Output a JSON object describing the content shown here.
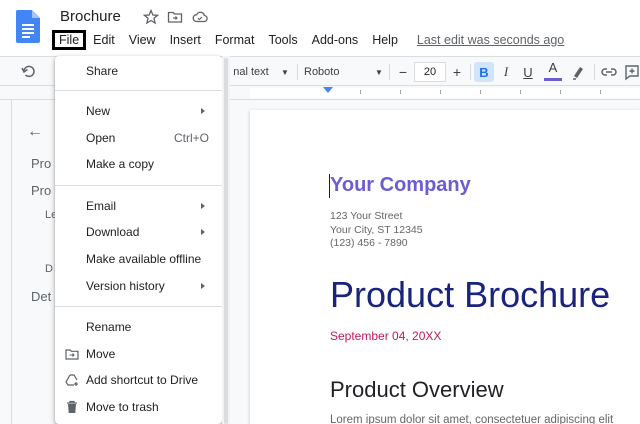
{
  "app": {
    "doc_title": "Brochure",
    "last_edit": "Last edit was seconds ago"
  },
  "menubar": [
    {
      "label": "File",
      "active": true
    },
    {
      "label": "Edit"
    },
    {
      "label": "View"
    },
    {
      "label": "Insert"
    },
    {
      "label": "Format"
    },
    {
      "label": "Tools"
    },
    {
      "label": "Add-ons"
    },
    {
      "label": "Help"
    }
  ],
  "toolbar": {
    "style_label": "nal text",
    "font_name": "Roboto",
    "font_size": "20",
    "minus": "−",
    "plus": "+",
    "bold": "B",
    "italic": "I",
    "underline": "U",
    "text_color": "A"
  },
  "file_menu": {
    "items": [
      {
        "label": "Share"
      },
      {
        "label": "New",
        "submenu": true
      },
      {
        "label": "Open",
        "shortcut": "Ctrl+O"
      },
      {
        "label": "Make a copy"
      },
      {
        "label": "Email",
        "submenu": true
      },
      {
        "label": "Download",
        "submenu": true
      },
      {
        "label": "Make available offline"
      },
      {
        "label": "Version history",
        "submenu": true
      },
      {
        "label": "Rename"
      },
      {
        "label": "Move",
        "icon": "folder-move-icon"
      },
      {
        "label": "Add shortcut to Drive",
        "icon": "add-shortcut-icon"
      },
      {
        "label": "Move to trash",
        "icon": "trash-icon"
      }
    ]
  },
  "outline": {
    "items": [
      "Pro",
      "Pro",
      "Le",
      "D",
      "Det"
    ]
  },
  "document": {
    "company": "Your Company",
    "address_line1": "123 Your Street",
    "address_line2": "Your City, ST 12345",
    "phone": "(123) 456 - 7890",
    "title": "Product Brochure",
    "date": "September 04, 20XX",
    "section_heading": "Product Overview",
    "body_start": "Lorem ipsum dolor sit amet, consectetuer adipiscing elit"
  },
  "colors": {
    "company": "#6c5dd3",
    "title": "#1a237e",
    "date": "#c2185b",
    "accent": "#1a73e8"
  }
}
